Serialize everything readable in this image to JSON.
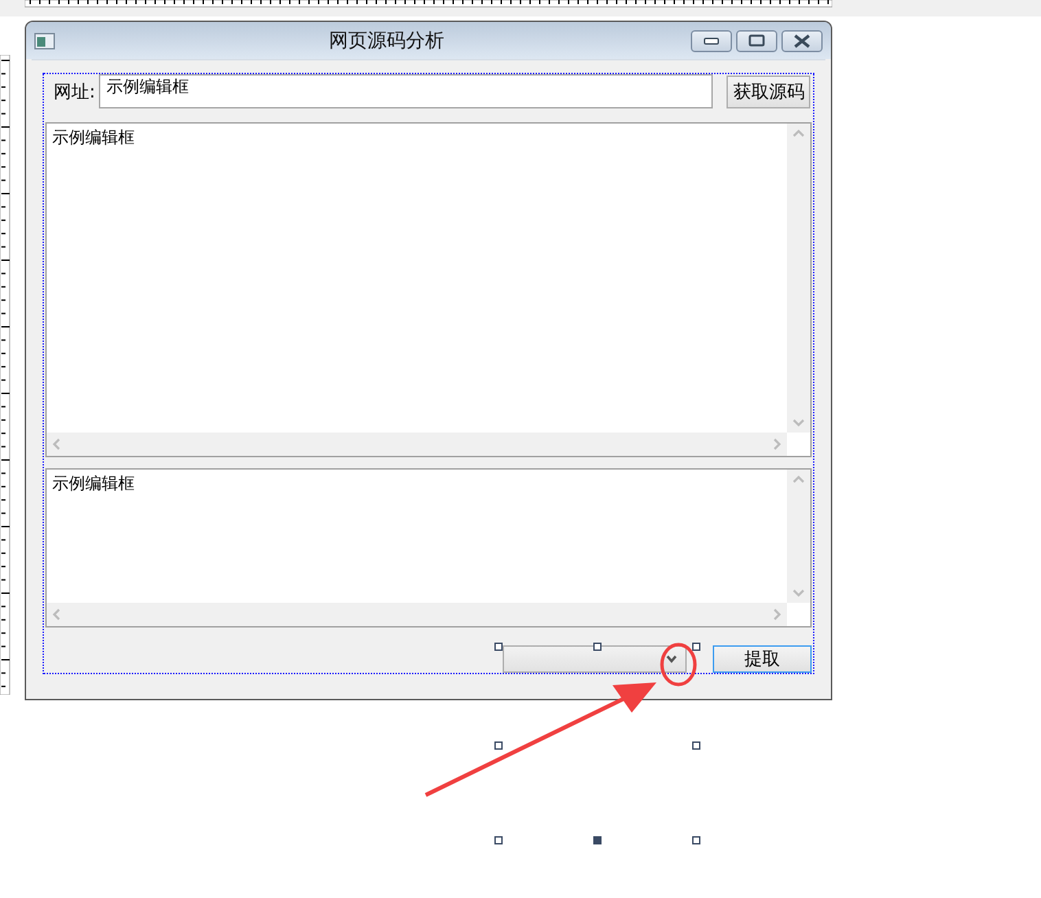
{
  "window": {
    "title": "网页源码分析"
  },
  "url_label": "网址:",
  "url_field": {
    "value": "示例编辑框"
  },
  "fetch_button": "获取源码",
  "source_box": {
    "value": "示例编辑框"
  },
  "result_box": {
    "value": "示例编辑框"
  },
  "extract_button": "提取"
}
